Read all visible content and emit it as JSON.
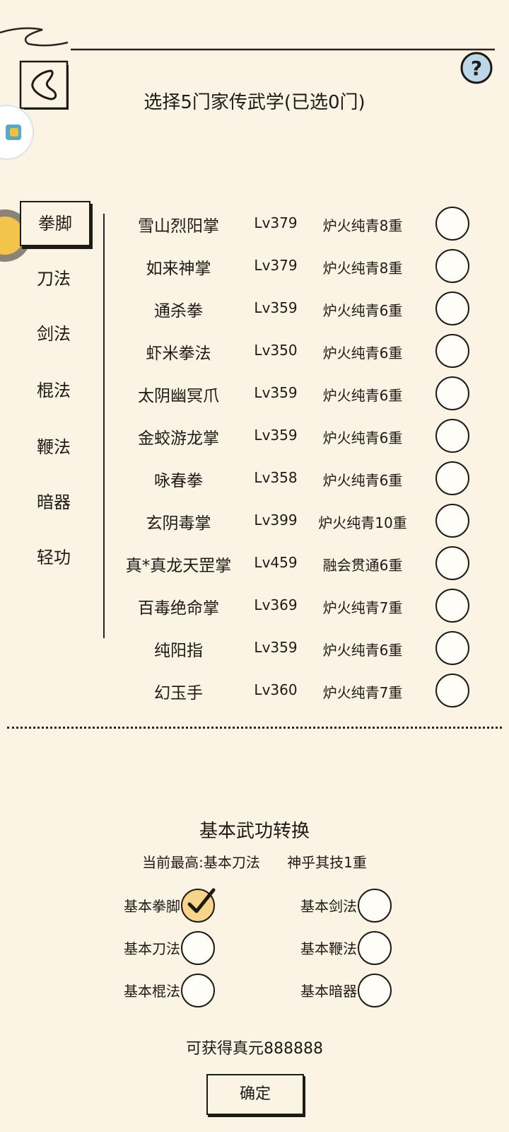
{
  "header": {
    "title": "选择5门家传武学(已选0门)"
  },
  "categories": [
    {
      "label": "拳脚",
      "active": true
    },
    {
      "label": "刀法",
      "active": false
    },
    {
      "label": "剑法",
      "active": false
    },
    {
      "label": "棍法",
      "active": false
    },
    {
      "label": "鞭法",
      "active": false
    },
    {
      "label": "暗器",
      "active": false
    },
    {
      "label": "轻功",
      "active": false
    }
  ],
  "skills": [
    {
      "name": "雪山烈阳掌",
      "level": "Lv379",
      "rank": "炉火纯青8重",
      "selected": false
    },
    {
      "name": "如来神掌",
      "level": "Lv379",
      "rank": "炉火纯青8重",
      "selected": false
    },
    {
      "name": "通杀拳",
      "level": "Lv359",
      "rank": "炉火纯青6重",
      "selected": false
    },
    {
      "name": "虾米拳法",
      "level": "Lv350",
      "rank": "炉火纯青6重",
      "selected": false
    },
    {
      "name": "太阴幽冥爪",
      "level": "Lv359",
      "rank": "炉火纯青6重",
      "selected": false
    },
    {
      "name": "金蛟游龙掌",
      "level": "Lv359",
      "rank": "炉火纯青6重",
      "selected": false
    },
    {
      "name": "咏春拳",
      "level": "Lv358",
      "rank": "炉火纯青6重",
      "selected": false
    },
    {
      "name": "玄阴毒掌",
      "level": "Lv399",
      "rank": "炉火纯青10重",
      "selected": false
    },
    {
      "name": "真*真龙天罡掌",
      "level": "Lv459",
      "rank": "融会贯通6重",
      "selected": false
    },
    {
      "name": "百毒绝命掌",
      "level": "Lv369",
      "rank": "炉火纯青7重",
      "selected": false
    },
    {
      "name": "纯阳指",
      "level": "Lv359",
      "rank": "炉火纯青6重",
      "selected": false
    },
    {
      "name": "幻玉手",
      "level": "Lv360",
      "rank": "炉火纯青7重",
      "selected": false
    }
  ],
  "conversion": {
    "title": "基本武功转换",
    "current_best": "当前最高:基本刀法",
    "current_rank": "神乎其技1重",
    "options": [
      {
        "label": "基本拳脚",
        "checked": true
      },
      {
        "label": "基本剑法",
        "checked": false
      },
      {
        "label": "基本刀法",
        "checked": false
      },
      {
        "label": "基本鞭法",
        "checked": false
      },
      {
        "label": "基本棍法",
        "checked": false
      },
      {
        "label": "基本暗器",
        "checked": false
      }
    ],
    "reward": "可获得真元888888",
    "confirm_label": "确定"
  },
  "icons": {
    "back": "back-arrow-icon",
    "help": "question-mark-icon",
    "check": "checkmark-icon"
  },
  "colors": {
    "background": "#fbf3e3",
    "ink": "#1e1a16",
    "checked_fill": "#f6d58a"
  }
}
